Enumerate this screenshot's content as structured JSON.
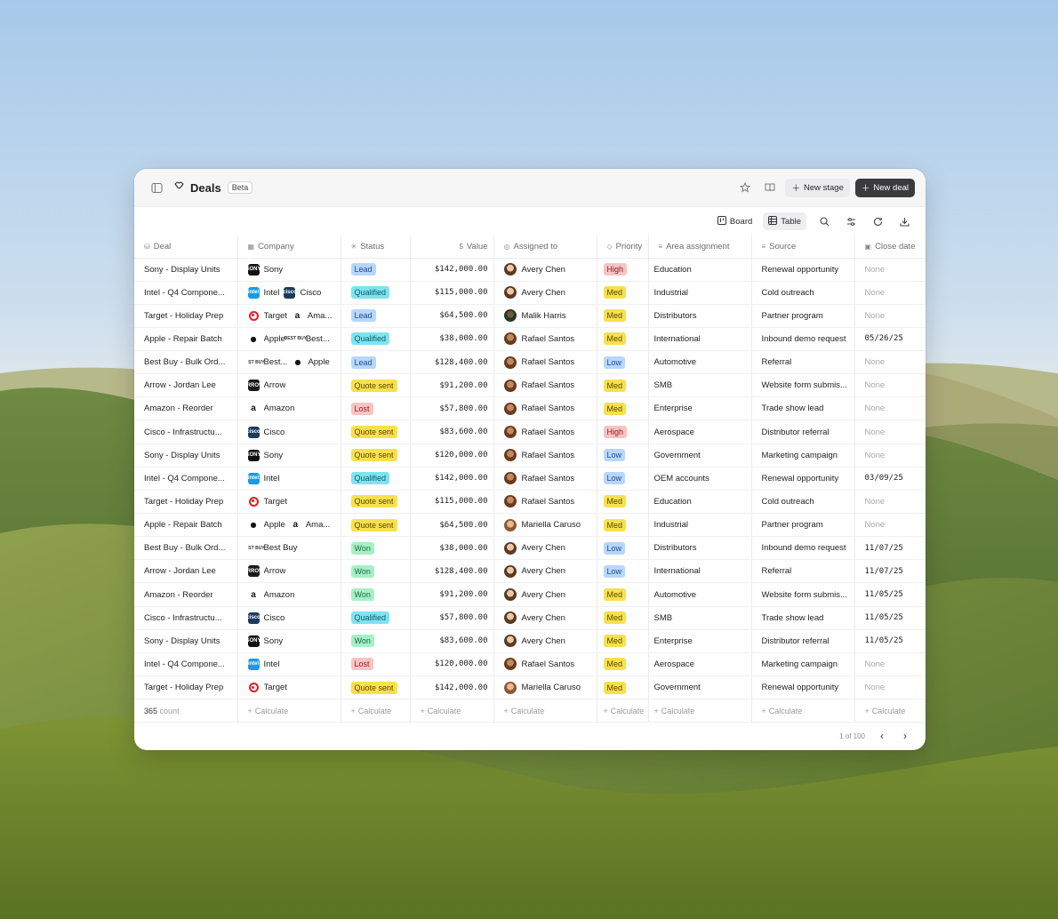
{
  "app": {
    "title": "Deals",
    "badge": "Beta",
    "new_stage_label": "New stage",
    "new_deal_label": "New deal"
  },
  "views": {
    "board_label": "Board",
    "table_label": "Table",
    "active": "Table"
  },
  "columns": {
    "deal": "Deal",
    "company": "Company",
    "status": "Status",
    "value": "Value",
    "assigned": "Assigned to",
    "priority": "Priority",
    "area": "Area assignment",
    "source": "Source",
    "close": "Close date"
  },
  "rows": [
    {
      "deal": "Sony - Display Units",
      "companies": [
        {
          "name": "Sony",
          "logo": "sony"
        }
      ],
      "status": "Lead",
      "value": "$142,000.00",
      "assigned": "Avery Chen",
      "avatar": "avery",
      "priority": "High",
      "area": "Education",
      "source": "Renewal opportunity",
      "close": "None"
    },
    {
      "deal": "Intel - Q4 Compone...",
      "companies": [
        {
          "name": "Intel",
          "logo": "intel"
        },
        {
          "name": "Cisco",
          "logo": "cisco"
        }
      ],
      "status": "Qualified",
      "value": "$115,000.00",
      "assigned": "Avery Chen",
      "avatar": "avery",
      "priority": "Med",
      "area": "Industrial",
      "source": "Cold outreach",
      "close": "None"
    },
    {
      "deal": "Target - Holiday Prep",
      "companies": [
        {
          "name": "Target",
          "logo": "target"
        },
        {
          "name": "Ama...",
          "logo": "amazon"
        }
      ],
      "status": "Lead",
      "value": "$64,500.00",
      "assigned": "Malik Harris",
      "avatar": "malik",
      "priority": "Med",
      "area": "Distributors",
      "source": "Partner program",
      "close": "None"
    },
    {
      "deal": "Apple - Repair Batch",
      "companies": [
        {
          "name": "Apple",
          "logo": "apple"
        },
        {
          "name": "Best...",
          "logo": "bestbuy"
        }
      ],
      "status": "Qualified",
      "value": "$38,000.00",
      "assigned": "Rafael Santos",
      "avatar": "rafael",
      "priority": "Med",
      "area": "International",
      "source": "Inbound demo request",
      "close": "05/26/25"
    },
    {
      "deal": "Best Buy - Bulk Ord...",
      "companies": [
        {
          "name": "Best...",
          "logo": "bestbuy"
        },
        {
          "name": "Apple",
          "logo": "apple"
        }
      ],
      "status": "Lead",
      "value": "$128,400.00",
      "assigned": "Rafael Santos",
      "avatar": "rafael",
      "priority": "Low",
      "area": "Automotive",
      "source": "Referral",
      "close": "None"
    },
    {
      "deal": "Arrow - Jordan Lee",
      "companies": [
        {
          "name": "Arrow",
          "logo": "arrow"
        }
      ],
      "status": "Quote sent",
      "value": "$91,200.00",
      "assigned": "Rafael Santos",
      "avatar": "rafael",
      "priority": "Med",
      "area": "SMB",
      "source": "Website form submis...",
      "close": "None"
    },
    {
      "deal": "Amazon - Reorder",
      "companies": [
        {
          "name": "Amazon",
          "logo": "amazon"
        }
      ],
      "status": "Lost",
      "value": "$57,800.00",
      "assigned": "Rafael Santos",
      "avatar": "rafael",
      "priority": "Med",
      "area": "Enterprise",
      "source": "Trade show lead",
      "close": "None"
    },
    {
      "deal": "Cisco - Infrastructu...",
      "companies": [
        {
          "name": "Cisco",
          "logo": "cisco"
        }
      ],
      "status": "Quote sent",
      "value": "$83,600.00",
      "assigned": "Rafael Santos",
      "avatar": "rafael",
      "priority": "High",
      "area": "Aerospace",
      "source": "Distributor referral",
      "close": "None"
    },
    {
      "deal": "Sony - Display Units",
      "companies": [
        {
          "name": "Sony",
          "logo": "sony"
        }
      ],
      "status": "Quote sent",
      "value": "$120,000.00",
      "assigned": "Rafael Santos",
      "avatar": "rafael",
      "priority": "Low",
      "area": "Government",
      "source": "Marketing campaign",
      "close": "None"
    },
    {
      "deal": "Intel - Q4 Compone...",
      "companies": [
        {
          "name": "Intel",
          "logo": "intel"
        }
      ],
      "status": "Qualified",
      "value": "$142,000.00",
      "assigned": "Rafael Santos",
      "avatar": "rafael",
      "priority": "Low",
      "area": "OEM accounts",
      "source": "Renewal opportunity",
      "close": "03/09/25"
    },
    {
      "deal": "Target - Holiday Prep",
      "companies": [
        {
          "name": "Target",
          "logo": "target"
        }
      ],
      "status": "Quote sent",
      "value": "$115,000.00",
      "assigned": "Rafael Santos",
      "avatar": "rafael",
      "priority": "Med",
      "area": "Education",
      "source": "Cold outreach",
      "close": "None"
    },
    {
      "deal": "Apple - Repair Batch",
      "companies": [
        {
          "name": "Apple",
          "logo": "apple"
        },
        {
          "name": "Ama...",
          "logo": "amazon"
        }
      ],
      "status": "Quote sent",
      "value": "$64,500.00",
      "assigned": "Mariella Caruso",
      "avatar": "mariella",
      "priority": "Med",
      "area": "Industrial",
      "source": "Partner program",
      "close": "None"
    },
    {
      "deal": "Best Buy - Bulk Ord...",
      "companies": [
        {
          "name": "Best Buy",
          "logo": "bestbuy"
        }
      ],
      "status": "Won",
      "value": "$38,000.00",
      "assigned": "Avery Chen",
      "avatar": "avery",
      "priority": "Low",
      "area": "Distributors",
      "source": "Inbound demo request",
      "close": "11/07/25"
    },
    {
      "deal": "Arrow - Jordan Lee",
      "companies": [
        {
          "name": "Arrow",
          "logo": "arrow"
        }
      ],
      "status": "Won",
      "value": "$128,400.00",
      "assigned": "Avery Chen",
      "avatar": "avery",
      "priority": "Low",
      "area": "International",
      "source": "Referral",
      "close": "11/07/25"
    },
    {
      "deal": "Amazon - Reorder",
      "companies": [
        {
          "name": "Amazon",
          "logo": "amazon"
        }
      ],
      "status": "Won",
      "value": "$91,200.00",
      "assigned": "Avery Chen",
      "avatar": "avery",
      "priority": "Med",
      "area": "Automotive",
      "source": "Website form submis...",
      "close": "11/05/25"
    },
    {
      "deal": "Cisco - Infrastructu...",
      "companies": [
        {
          "name": "Cisco",
          "logo": "cisco"
        }
      ],
      "status": "Qualified",
      "value": "$57,800.00",
      "assigned": "Avery Chen",
      "avatar": "avery",
      "priority": "Med",
      "area": "SMB",
      "source": "Trade show lead",
      "close": "11/05/25"
    },
    {
      "deal": "Sony - Display Units",
      "companies": [
        {
          "name": "Sony",
          "logo": "sony"
        }
      ],
      "status": "Won",
      "value": "$83,600.00",
      "assigned": "Avery Chen",
      "avatar": "avery",
      "priority": "Med",
      "area": "Enterprise",
      "source": "Distributor referral",
      "close": "11/05/25"
    },
    {
      "deal": "Intel - Q4 Compone...",
      "companies": [
        {
          "name": "Intel",
          "logo": "intel"
        }
      ],
      "status": "Lost",
      "value": "$120,000.00",
      "assigned": "Rafael Santos",
      "avatar": "rafael",
      "priority": "Med",
      "area": "Aerospace",
      "source": "Marketing campaign",
      "close": "None"
    },
    {
      "deal": "Target - Holiday Prep",
      "companies": [
        {
          "name": "Target",
          "logo": "target"
        }
      ],
      "status": "Quote sent",
      "value": "$142,000.00",
      "assigned": "Mariella Caruso",
      "avatar": "mariella",
      "priority": "Med",
      "area": "Government",
      "source": "Renewal opportunity",
      "close": "None"
    }
  ],
  "footer": {
    "count_value": "365",
    "count_label": "count",
    "calculate_label": "Calculate"
  },
  "pagination": {
    "text": "1 of 100"
  }
}
